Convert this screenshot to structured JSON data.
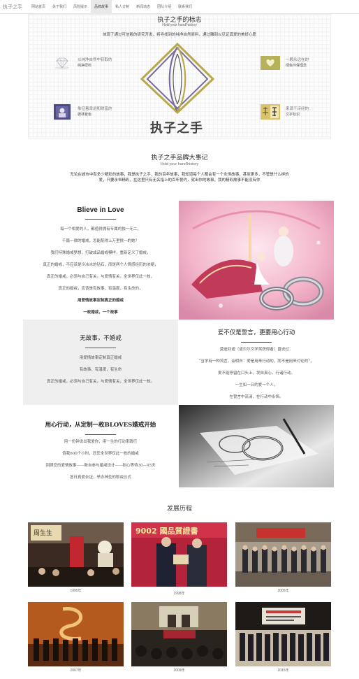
{
  "nav": {
    "brand": "执子之手",
    "items": [
      "网站首页",
      "关于我们",
      "风险提示",
      "品牌故事",
      "私人订制",
      "新闻动态",
      "团队介绍",
      "联系我们"
    ],
    "active_index": 3
  },
  "logo_section": {
    "title": "执子之手的标志",
    "subtitle": "Hold your hand'history",
    "description": "体现了通过可信赖的研究开发，将寻找到的纯净自然原料，通过雕刻以见证真爱的美好心愿",
    "features": [
      {
        "title": "以纯净自然中获取的",
        "label": "纯净原料",
        "icon": "diamond-icon"
      },
      {
        "title": "一颗永远在的",
        "label": "绿色环保理念",
        "icon": "heart-icon"
      },
      {
        "title": "象征着幸运和财富的",
        "label": "德林紫色",
        "icon": "portrait-icon"
      },
      {
        "title": "来源于诗经的",
        "label": "文字标识",
        "icon": "calligraphy-icon"
      }
    ],
    "logo_text": "执子之手"
  },
  "story_section": {
    "title": "执子之手品牌大事记",
    "subtitle": "Hold your hand'history",
    "description": "无论在城市中有多少精彩的故事，我是执子之手，我的百年故事，我知道每个人都会有一个永恒故事，甚至更多，不管是什么样的爱，只要永恒精彩，在这里只有无名指上的百年誓约，就出你的故事，我的精彩故事不能没有你"
  },
  "blieve": {
    "heading": "Blieve in Love",
    "lines": [
      "每一个相爱的人，都值得拥有专属的独一无二，",
      "千篇一律的婚戒，怎能配得上万里挑一的她？",
      "我们特殊婚戒梦想，打破成品婚戒模样，重新定义了婚戒，",
      "真正的婚戒，不应该是冷冰冰的钻石，而是两个人情感经历的浓缩，",
      "真正的婚戒，必须与自己有关，与爱情有关，全世界仅此一枚，",
      "真正的婚戒，应该是有故事，有温度，有生命的，"
    ],
    "bold_lines": [
      "用爱情故事定制真正的婚戒",
      "一枚婚戒，一个故事"
    ]
  },
  "no_story": {
    "heading": "无故事，不婚戒",
    "lines": [
      "用爱情故事定制真正婚戒",
      "有故事，有温度，有生命",
      "真正的婚戒，必须与自己有关，与爱情有关，全世界仅此一枚。"
    ]
  },
  "promise": {
    "heading": "爱不仅是誓言，更要用心行动",
    "lines": [
      "莫迪亚诺（诺贝尔文学奖获得者）曾说过：",
      "“当学有一种流言，会明白：爱是用来行动的，而不是用来讨论的”，",
      "爱不能停留在口头上，发自真心，行诸行动。",
      "一生如一日的爱一个人，",
      "在誓言中流淌，在行动中永恒。"
    ]
  },
  "custom": {
    "heading": "用心行动，从定制一枚BLOVES婚戒开始",
    "lines": [
      "用一份钟说出我爱你，用一生的行动来践行",
      "倍我600个小时，还您全世界仅此一枚的婚戒",
      "回顾您的爱情故事——新自参与婚戒设计——耐心等待30—45天",
      "答日真爱永证，举办神圣的取戒仪式"
    ]
  },
  "history": {
    "title": "发展历程",
    "items": [
      {
        "year": "1995年"
      },
      {
        "year": "1998年",
        "banner": "9002 國品質證書"
      },
      {
        "year": "2005年"
      },
      {
        "year": "2007年"
      },
      {
        "year": "2009年"
      },
      {
        "year": "2015年"
      }
    ]
  },
  "colors": {
    "accent_purple": "#7a6aa0",
    "accent_olive": "#b7a94a",
    "grey_panel": "#efefef",
    "banner_red": "#c32a3e"
  }
}
